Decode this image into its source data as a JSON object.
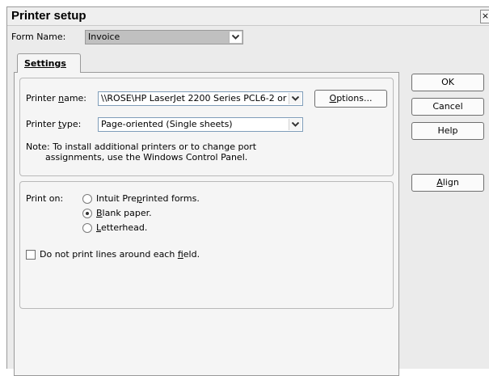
{
  "window": {
    "title": "Printer setup",
    "close_glyph": "×"
  },
  "form_name": {
    "label_pre": "Form Name:",
    "value": "Invoice"
  },
  "tab": {
    "label": "Settings"
  },
  "printer_name": {
    "label_pre": "Printer ",
    "label_mn": "n",
    "label_post": "ame:",
    "value": "\\\\ROSE\\HP LaserJet 2200 Series PCL6-2 or"
  },
  "printer_type": {
    "label_pre": "Printer ",
    "label_mn": "t",
    "label_post": "ype:",
    "value": "Page-oriented (Single sheets)"
  },
  "options_button": {
    "pre": "",
    "mn": "O",
    "post": "ptions..."
  },
  "note": {
    "line1": "Note: To install additional printers or to change port",
    "line2": "assignments, use the Windows Control Panel."
  },
  "print_on": {
    "label": "Print on:",
    "options": [
      {
        "pre": "Intuit Pre",
        "mn": "p",
        "post": "rinted forms.",
        "checked": false
      },
      {
        "pre": "",
        "mn": "B",
        "post": "lank paper.",
        "checked": true
      },
      {
        "pre": "",
        "mn": "L",
        "post": "etterhead.",
        "checked": false
      }
    ]
  },
  "no_lines_checkbox": {
    "pre": "Do not print lines around each ",
    "mn": "f",
    "post": "ield.",
    "checked": false
  },
  "buttons": {
    "ok": "OK",
    "cancel": "Cancel",
    "help": "Help",
    "align_mn": "A",
    "align_post": "lign"
  },
  "icons": {
    "dropdown": "chevron-down-icon",
    "close": "close-icon"
  }
}
